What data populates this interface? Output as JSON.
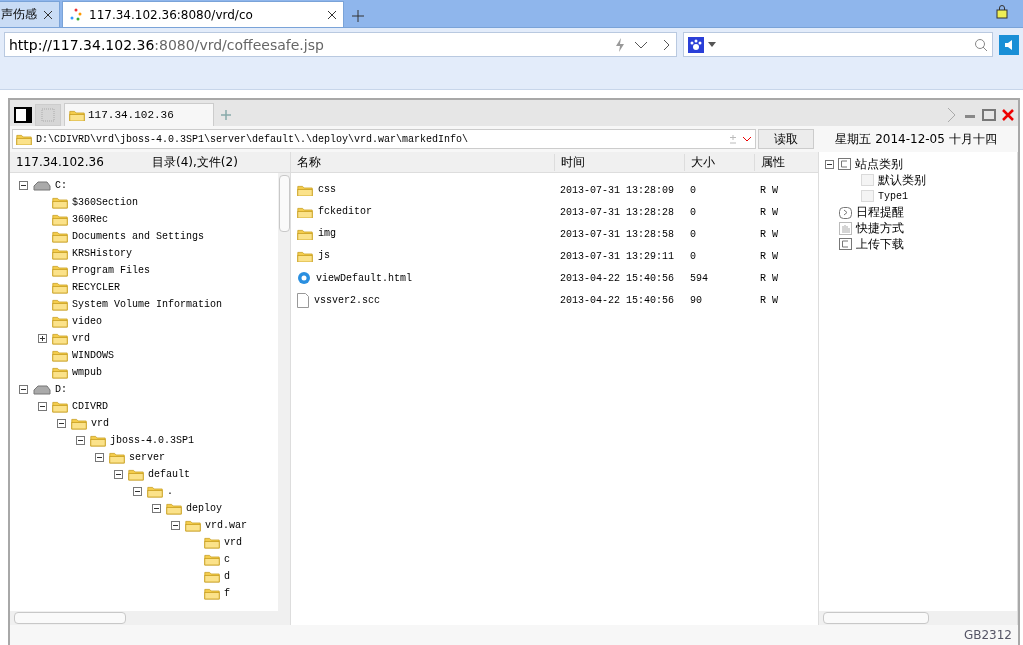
{
  "browser": {
    "tabs": [
      {
        "label": "声伤感",
        "selected": false
      },
      {
        "label": "117.34.102.36:8080/vrd/co",
        "selected": true
      }
    ],
    "address": {
      "host": "http://117.34.102.36",
      "rest": ":8080/vrd/coffeesafe.jsp"
    }
  },
  "app": {
    "tabs": [
      {
        "label": "117.34.102.36",
        "selected": true
      }
    ],
    "path": "D:\\CDIVRD\\vrd\\jboss-4.0.3SP1\\server\\default\\.\\deploy\\vrd.war\\markedInfo\\",
    "read_button": "读取",
    "date": {
      "weekday": "星期五",
      "date": "2014-12-05",
      "lunar": "十月十四"
    },
    "tree_header": {
      "host": "117.34.102.36",
      "counts": "目录(4),文件(2)"
    },
    "tree": [
      {
        "label": "C:",
        "kind": "drive",
        "expanded": true,
        "children": [
          {
            "label": "$360Section",
            "kind": "folder"
          },
          {
            "label": "360Rec",
            "kind": "folder"
          },
          {
            "label": "Documents and Settings",
            "kind": "folder"
          },
          {
            "label": "KRSHistory",
            "kind": "folder"
          },
          {
            "label": "Program Files",
            "kind": "folder"
          },
          {
            "label": "RECYCLER",
            "kind": "folder"
          },
          {
            "label": "System Volume Information",
            "kind": "folder"
          },
          {
            "label": "video",
            "kind": "folder"
          },
          {
            "label": "vrd",
            "kind": "folder",
            "expanded": false
          },
          {
            "label": "WINDOWS",
            "kind": "folder"
          },
          {
            "label": "wmpub",
            "kind": "folder"
          }
        ]
      },
      {
        "label": "D:",
        "kind": "drive",
        "expanded": true,
        "children": [
          {
            "label": "CDIVRD",
            "kind": "folder",
            "expanded": true,
            "children": [
              {
                "label": "vrd",
                "kind": "folder",
                "expanded": true,
                "children": [
                  {
                    "label": "jboss-4.0.3SP1",
                    "kind": "folder",
                    "expanded": true,
                    "children": [
                      {
                        "label": "server",
                        "kind": "folder",
                        "expanded": true,
                        "children": [
                          {
                            "label": "default",
                            "kind": "folder",
                            "expanded": true,
                            "children": [
                              {
                                "label": ".",
                                "kind": "folder",
                                "expanded": true,
                                "children": [
                                  {
                                    "label": "deploy",
                                    "kind": "folder",
                                    "expanded": true,
                                    "children": [
                                      {
                                        "label": "vrd.war",
                                        "kind": "folder",
                                        "expanded": true,
                                        "children": [
                                          {
                                            "label": "vrd",
                                            "kind": "folder"
                                          },
                                          {
                                            "label": "c",
                                            "kind": "folder"
                                          },
                                          {
                                            "label": "d",
                                            "kind": "folder"
                                          },
                                          {
                                            "label": "f",
                                            "kind": "folder"
                                          }
                                        ]
                                      }
                                    ]
                                  }
                                ]
                              }
                            ]
                          }
                        ]
                      }
                    ]
                  }
                ]
              }
            ]
          }
        ]
      }
    ],
    "columns": [
      "名称",
      "时间",
      "大小",
      "属性"
    ],
    "files": [
      {
        "name": "css",
        "kind": "folder",
        "time": "2013-07-31 13:28:09",
        "size": "0",
        "attr": "R W"
      },
      {
        "name": "fckeditor",
        "kind": "folder",
        "time": "2013-07-31 13:28:28",
        "size": "0",
        "attr": "R W"
      },
      {
        "name": "img",
        "kind": "folder",
        "time": "2013-07-31 13:28:58",
        "size": "0",
        "attr": "R W"
      },
      {
        "name": "js",
        "kind": "folder",
        "time": "2013-07-31 13:29:11",
        "size": "0",
        "attr": "R W"
      },
      {
        "name": "viewDefault.html",
        "kind": "html",
        "time": "2013-04-22 15:40:56",
        "size": "594",
        "attr": "R W"
      },
      {
        "name": "vssver2.scc",
        "kind": "file",
        "time": "2013-04-22 15:40:56",
        "size": "90",
        "attr": "R W"
      }
    ],
    "side_tree": [
      {
        "label": "站点类别",
        "kind": "category",
        "expanded": true,
        "children": [
          {
            "label": "默认类别",
            "kind": "item"
          },
          {
            "label": "Type1",
            "kind": "item"
          }
        ]
      },
      {
        "label": "日程提醒",
        "kind": "schedule"
      },
      {
        "label": "快捷方式",
        "kind": "shortcut"
      },
      {
        "label": "上传下载",
        "kind": "transfer"
      }
    ],
    "encoding": "GB2312"
  }
}
